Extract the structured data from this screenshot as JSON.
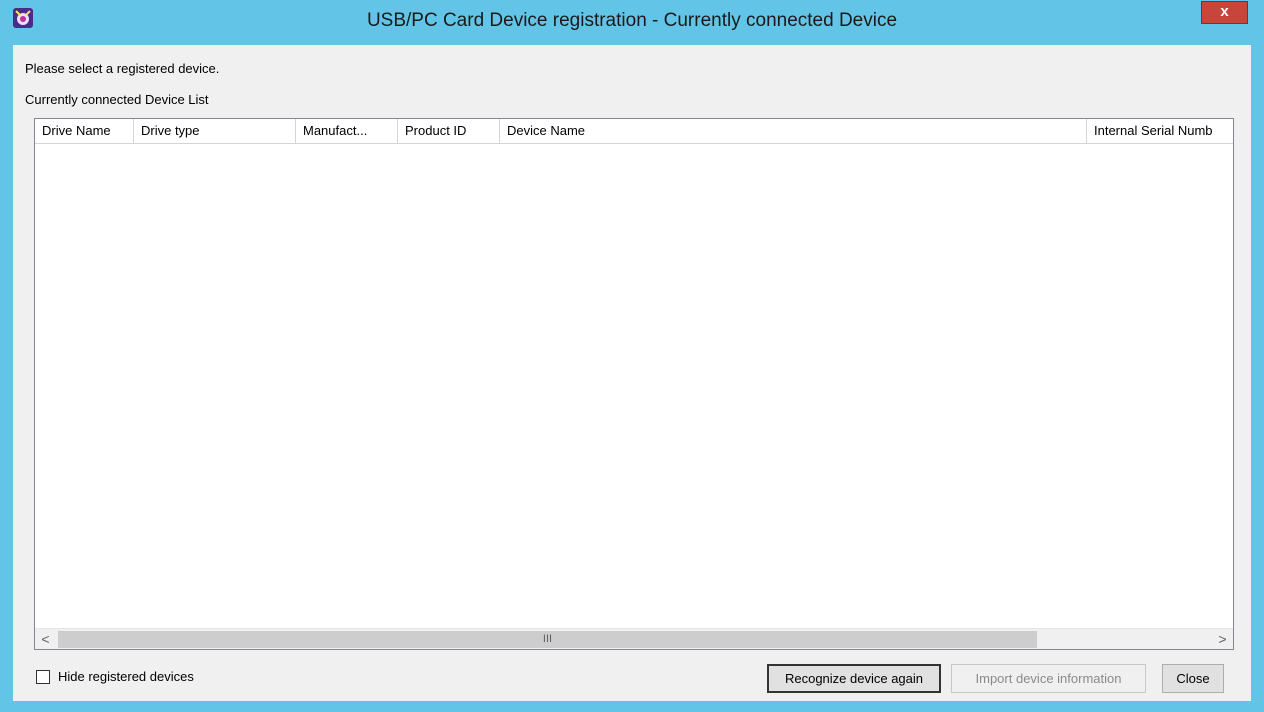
{
  "window": {
    "title": "USB/PC Card Device registration - Currently connected Device",
    "close_label": "x",
    "app_icon": "device-app-icon"
  },
  "instructions": "Please select a registered device.",
  "list_label": "Currently connected Device List",
  "table": {
    "columns": [
      "Drive Name",
      "Drive type",
      "Manufact...",
      "Product ID",
      "Device Name",
      "Internal Serial Numb"
    ],
    "rows": []
  },
  "scrollbar": {
    "left_arrow": "<",
    "right_arrow": ">",
    "grip": "III"
  },
  "hide_registered": {
    "label": "Hide registered devices",
    "checked": false
  },
  "buttons": {
    "recognize": "Recognize device again",
    "import": "Import device information",
    "close": "Close"
  },
  "colors": {
    "frame": "#62c5e8",
    "close_button": "#c7453b",
    "dialog_bg": "#f0f0f0"
  }
}
